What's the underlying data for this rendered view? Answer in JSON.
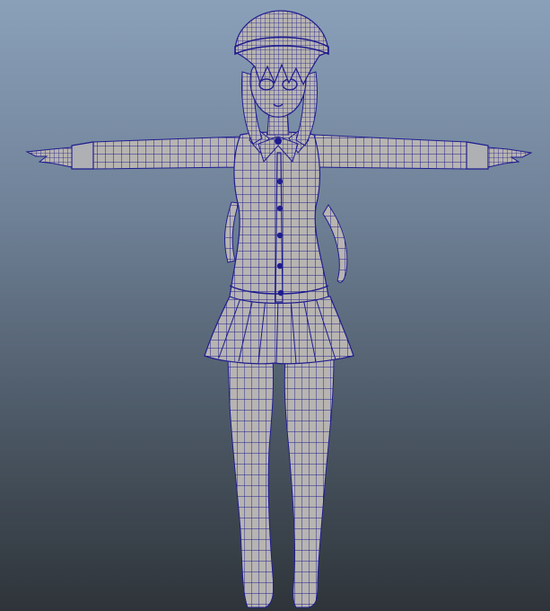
{
  "viewport": {
    "background_top_color": "#8aa0b9",
    "background_bottom_color": "#2e3439"
  },
  "model": {
    "view": "front",
    "pose": "T-pose",
    "display_mode": "wireframe-on-shaded",
    "shaded_color": "#b7b4b1",
    "wireframe_color": "#1f1d8f",
    "parts": [
      {
        "name": "head",
        "icon": "head-mesh"
      },
      {
        "name": "hair",
        "icon": "hair-mesh"
      },
      {
        "name": "collar-bow",
        "icon": "bow-mesh"
      },
      {
        "name": "shirt",
        "icon": "shirt-mesh"
      },
      {
        "name": "shirt-buttons",
        "count": 5
      },
      {
        "name": "arms",
        "icon": "arm-mesh"
      },
      {
        "name": "hands",
        "icon": "hand-mesh"
      },
      {
        "name": "skirt",
        "icon": "skirt-mesh"
      },
      {
        "name": "legs",
        "icon": "leg-mesh"
      }
    ]
  }
}
